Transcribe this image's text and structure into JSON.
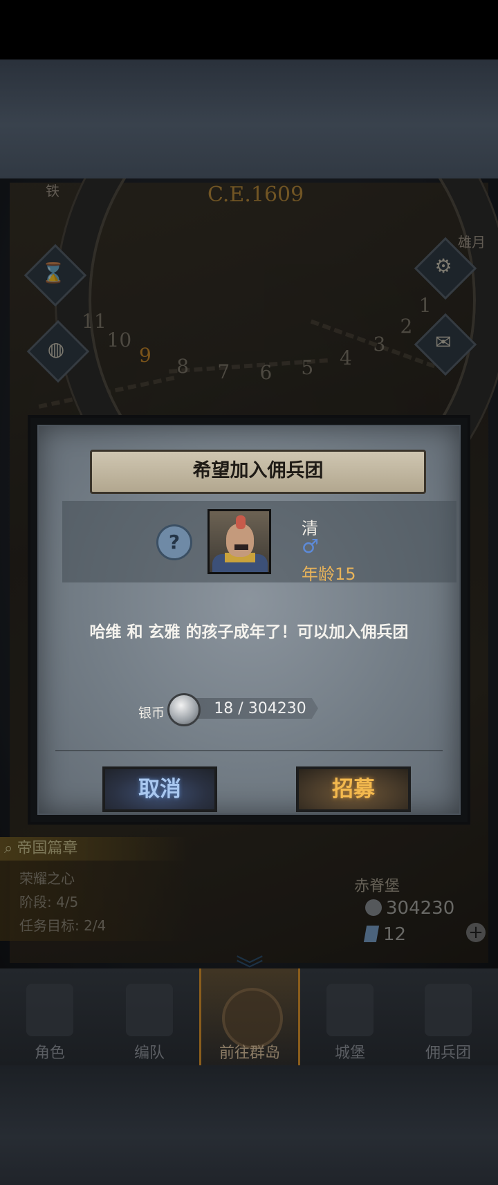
{
  "map": {
    "year": "C.E.1609",
    "calendar_numbers": [
      "1",
      "2",
      "3",
      "4",
      "5",
      "6",
      "7",
      "8",
      "9",
      "10",
      "11"
    ],
    "active_month": "9",
    "label_left": "铁",
    "label_right": "雄月"
  },
  "quest": {
    "title": "帝国篇章",
    "name": "荣耀之心",
    "stage": "阶段: 4/5",
    "goal": "任务目标: 2/4"
  },
  "castle": {
    "name": "赤脊堡",
    "silver": "304230",
    "gems": "12"
  },
  "nav": {
    "items": [
      {
        "label": "角色"
      },
      {
        "label": "编队"
      },
      {
        "label": "前往群岛"
      },
      {
        "label": "城堡"
      },
      {
        "label": "佣兵团"
      }
    ],
    "active_index": 2
  },
  "dialog": {
    "title": "希望加入佣兵团",
    "unknown_symbol": "?",
    "character": {
      "name": "清",
      "gender_symbol": "♂",
      "age_label": "年龄",
      "age": "15"
    },
    "message": "哈维 和 玄雅 的孩子成年了！可以加入佣兵团",
    "cost": {
      "label": "银币",
      "amount": "18 / 304230"
    },
    "cancel_label": "取消",
    "recruit_label": "招募"
  },
  "colors": {
    "accent_gold": "#e8b35a",
    "cancel_blue": "#a9c8f0",
    "recruit_orange": "#f3b94e"
  }
}
